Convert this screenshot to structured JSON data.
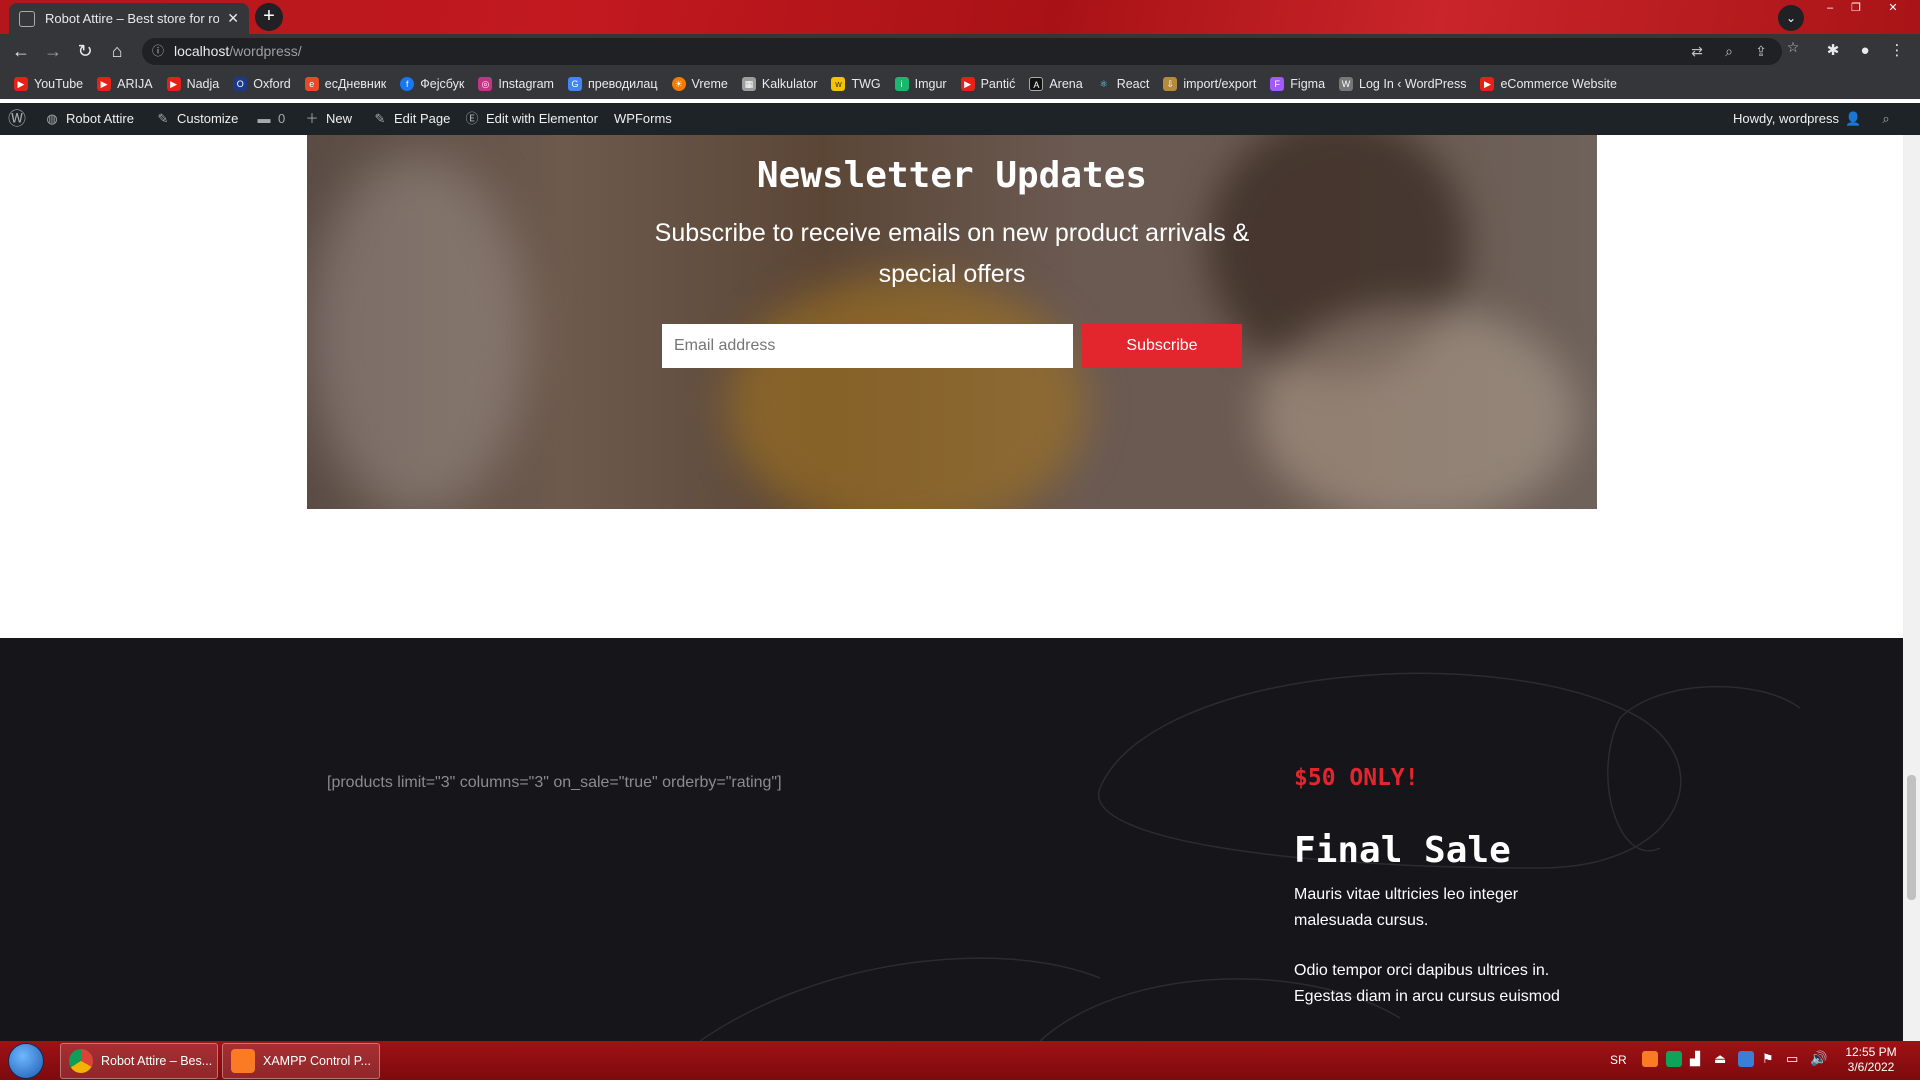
{
  "browser": {
    "tab_title": "Robot Attire – Best store for robo",
    "tab_close": "✕",
    "new_tab": "+",
    "url_host": "localhost",
    "url_path": "/wordpress/",
    "window_controls": [
      "–",
      "❐",
      "✕"
    ]
  },
  "bookmarks": [
    {
      "label": "YouTube",
      "icon": "youtube-icon",
      "color": "#e62117"
    },
    {
      "label": "ARIJA",
      "icon": "youtube-icon",
      "color": "#e62117"
    },
    {
      "label": "Nadja",
      "icon": "youtube-icon",
      "color": "#e62117"
    },
    {
      "label": "Oxford",
      "icon": "oup-icon",
      "color": "#1d3a8a"
    },
    {
      "label": "есДневник",
      "icon": "diary-icon",
      "color": "#e8492a"
    },
    {
      "label": "Фејсбук",
      "icon": "facebook-icon",
      "color": "#1877f2"
    },
    {
      "label": "Instagram",
      "icon": "instagram-icon",
      "color": "#c13584"
    },
    {
      "label": "преводилац",
      "icon": "translate-icon",
      "color": "#4285f4"
    },
    {
      "label": "Vreme",
      "icon": "weather-icon",
      "color": "#f57c00"
    },
    {
      "label": "Kalkulator",
      "icon": "calculator-icon",
      "color": "#9e9e9e"
    },
    {
      "label": "TWG",
      "icon": "twg-icon",
      "color": "#f5c400"
    },
    {
      "label": "Imgur",
      "icon": "imgur-icon",
      "color": "#1bb76e"
    },
    {
      "label": "Pantić",
      "icon": "youtube-icon",
      "color": "#e62117"
    },
    {
      "label": "Arena",
      "icon": "arena-icon",
      "color": "#333333"
    },
    {
      "label": "React",
      "icon": "react-icon",
      "color": "#61dafb"
    },
    {
      "label": "import/export",
      "icon": "import-icon",
      "color": "#b58a3c"
    },
    {
      "label": "Figma",
      "icon": "figma-icon",
      "color": "#a259ff"
    },
    {
      "label": "Log In ‹ WordPress",
      "icon": "wordpress-icon",
      "color": "#777777"
    },
    {
      "label": "eCommerce Website",
      "icon": "youtube-icon",
      "color": "#e62117"
    }
  ],
  "adminbar": {
    "site_name": "Robot Attire",
    "customize": "Customize",
    "comments_count": "0",
    "new": "New",
    "edit_page": "Edit Page",
    "edit_elementor": "Edit with Elementor",
    "wpforms": "WPForms",
    "howdy": "Howdy, wordpress"
  },
  "newsletter": {
    "title": "Newsletter Updates",
    "subtitle": "Subscribe to receive emails on new product arrivals & special offers",
    "email_placeholder": "Email address",
    "button": "Subscribe"
  },
  "sale": {
    "shortcode": "[products limit=\"3\" columns=\"3\" on_sale=\"true\" orderby=\"rating\"]",
    "price": "$50 ONLY!",
    "title": "Final Sale",
    "paragraph1": "Mauris vitae ultricies leo integer malesuada cursus.",
    "paragraph2": "Odio tempor orci dapibus ultrices in. Egestas diam in arcu cursus euismod"
  },
  "taskbar": {
    "tasks": [
      {
        "label": "Robot Attire – Bes...",
        "icon": "chrome-icon"
      },
      {
        "label": "XAMPP Control P...",
        "icon": "xampp-icon"
      }
    ],
    "language": "SR",
    "time": "12:55 PM",
    "date": "3/6/2022"
  },
  "colors": {
    "accent_red": "#e3252d",
    "footer_bg": "#16151a",
    "adminbar_bg": "#1d2327"
  }
}
